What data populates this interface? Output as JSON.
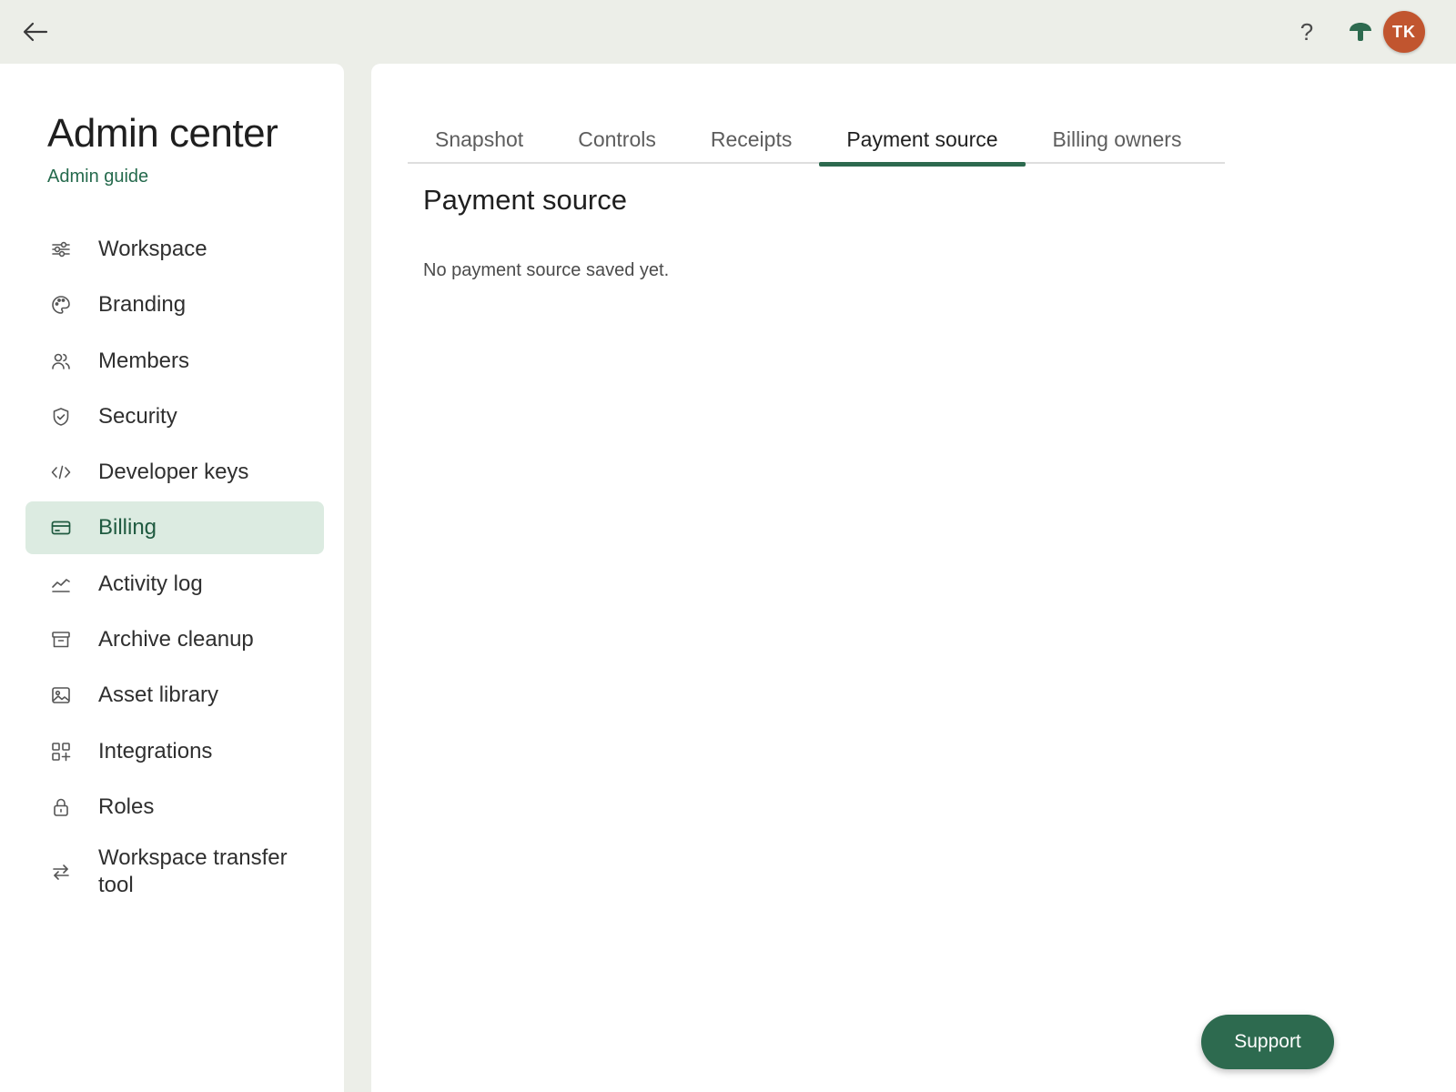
{
  "topbar": {
    "back_icon": "arrow-left-icon",
    "help_label": "?",
    "brand_icon": "mushroom-icon",
    "avatar_initials": "TK",
    "avatar_color": "#c1552f"
  },
  "sidebar": {
    "title": "Admin center",
    "guide_link": "Admin guide",
    "items": [
      {
        "label": "Workspace",
        "icon": "sliders-icon"
      },
      {
        "label": "Branding",
        "icon": "palette-icon"
      },
      {
        "label": "Members",
        "icon": "users-icon"
      },
      {
        "label": "Security",
        "icon": "shield-check-icon"
      },
      {
        "label": "Developer keys",
        "icon": "code-icon"
      },
      {
        "label": "Billing",
        "icon": "credit-card-icon",
        "active": true
      },
      {
        "label": "Activity log",
        "icon": "line-chart-icon"
      },
      {
        "label": "Archive cleanup",
        "icon": "archive-box-icon"
      },
      {
        "label": "Asset library",
        "icon": "image-icon"
      },
      {
        "label": "Integrations",
        "icon": "grid-plus-icon"
      },
      {
        "label": "Roles",
        "icon": "lock-icon"
      },
      {
        "label": "Workspace transfer tool",
        "icon": "transfer-arrows-icon"
      }
    ]
  },
  "main": {
    "tabs": [
      {
        "label": "Snapshot"
      },
      {
        "label": "Controls"
      },
      {
        "label": "Receipts"
      },
      {
        "label": "Payment source",
        "active": true
      },
      {
        "label": "Billing owners"
      }
    ],
    "section_title": "Payment source",
    "empty_message": "No payment source saved yet."
  },
  "support_button": {
    "label": "Support"
  },
  "colors": {
    "accent": "#2d6a4f",
    "active_nav_bg": "#dcebe1",
    "app_bg": "#eceee8",
    "link": "#256a4d"
  }
}
